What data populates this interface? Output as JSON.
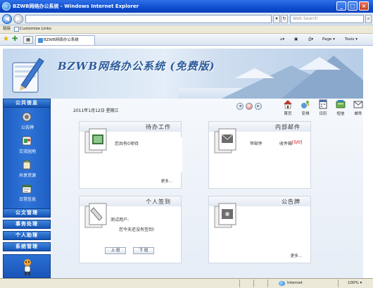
{
  "browser": {
    "title": "BZWB网络办公系统 - Windows Internet Explorer",
    "address": "",
    "search_placeholder": "Web Search",
    "links_label": "链接",
    "links_item": "Customize Links",
    "tab_label": "BZWB网络办公系统",
    "page_label": "Page ▾",
    "tools_label": "Tools ▾",
    "status_zone": "Internet",
    "zoom": "100% ▾",
    "min": "_",
    "max": "□",
    "close": "×",
    "back": "◀",
    "fwd": "▶",
    "star1": "★",
    "star2": "✚"
  },
  "app": {
    "banner_title": "BZWB网络办公系统 (免费版)",
    "date": "2011年1月12日  星期三",
    "sidebar": {
      "head_public": "公共信息",
      "items": [
        "公告牌",
        "交流园地",
        "共享资源",
        "日常信息"
      ],
      "menus": [
        "公文管理",
        "事务处理",
        "个人助理",
        "系统管理"
      ]
    },
    "toolbar": [
      "首页",
      "安排",
      "日历",
      "短信",
      "邮件"
    ],
    "panels": {
      "todo": {
        "title": "待办工作",
        "text": "您共有0项待",
        "more": "更多..."
      },
      "mail": {
        "title": "内部邮件",
        "text1": "苹邮件",
        "text2": "收件箱",
        "count": "[0/0]"
      },
      "signin": {
        "title": "个人签到",
        "line1": "测试用户:",
        "line2": "您今天还没有签到!",
        "btn_in": "上 班",
        "btn_out": "下 班"
      },
      "notice": {
        "title": "公告牌",
        "more": "更多..."
      }
    }
  },
  "colors": {
    "accent": "#1f5fc4",
    "banner_text": "#2e5c9a",
    "count_red": "#cc0000"
  }
}
